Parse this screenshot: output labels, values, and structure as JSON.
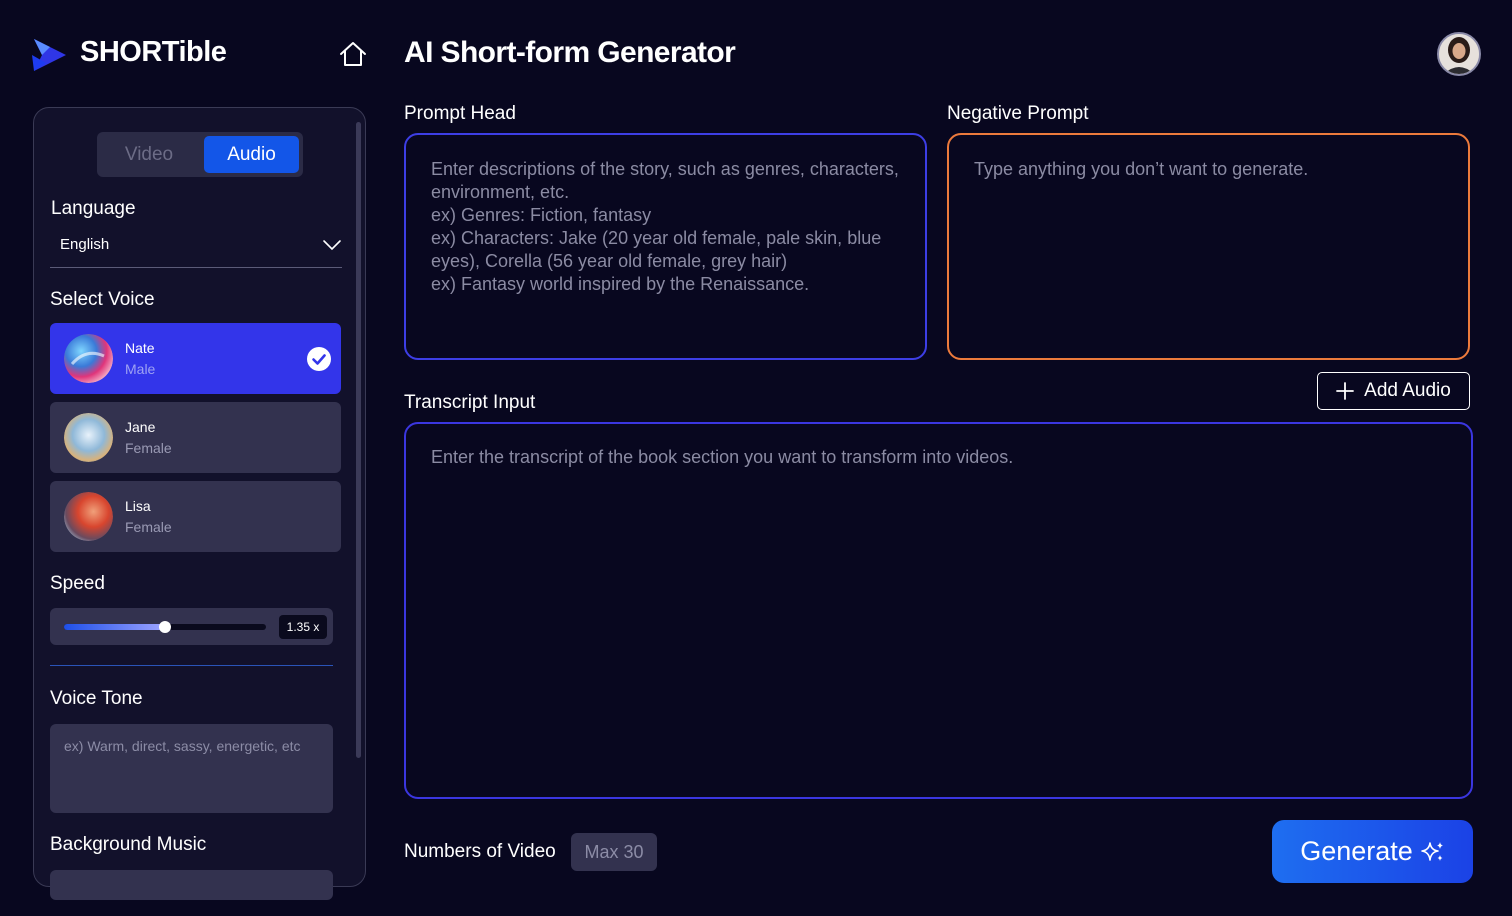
{
  "app": {
    "name": "SHORTible"
  },
  "header": {
    "title": "AI Short-form Generator",
    "home_icon": "home-icon",
    "avatar": "user-avatar"
  },
  "sidebar": {
    "tabs": [
      {
        "label": "Video",
        "selected": false
      },
      {
        "label": "Audio",
        "selected": true
      }
    ],
    "language": {
      "label": "Language",
      "value": "English"
    },
    "voice": {
      "label": "Select Voice",
      "items": [
        {
          "name": "Nate",
          "gender": "Male",
          "selected": true
        },
        {
          "name": "Jane",
          "gender": "Female",
          "selected": false
        },
        {
          "name": "Lisa",
          "gender": "Female",
          "selected": false
        }
      ]
    },
    "speed": {
      "label": "Speed",
      "value_text": "1.35 x",
      "fill_fraction": 0.5
    },
    "voice_tone": {
      "label": "Voice Tone",
      "placeholder": "ex) Warm, direct, sassy, energetic, etc"
    },
    "background_music": {
      "label": "Background Music"
    }
  },
  "main": {
    "prompt_head": {
      "label": "Prompt Head",
      "placeholder": "Enter descriptions of the story, such as genres, characters, environment, etc.\nex) Genres: Fiction, fantasy\nex) Characters: Jake (20 year old female, pale skin, blue eyes), Corella (56 year old female, grey hair)\nex) Fantasy world inspired by the Renaissance."
    },
    "negative_prompt": {
      "label": "Negative Prompt",
      "placeholder": "Type anything you don’t want to generate."
    },
    "transcript": {
      "label": "Transcript Input",
      "placeholder": "Enter the transcript of the book section you want to transform into videos."
    },
    "add_audio_label": "Add Audio",
    "numbers_of_video": {
      "label": "Numbers of Video",
      "placeholder": "Max 30"
    },
    "generate_label": "Generate"
  },
  "colors": {
    "background": "#08071f",
    "accent_blue": "#1356e8",
    "voice_selected": "#3335ea",
    "prompt_border": "#3d3ee5",
    "negative_border": "#ec7a3c"
  }
}
